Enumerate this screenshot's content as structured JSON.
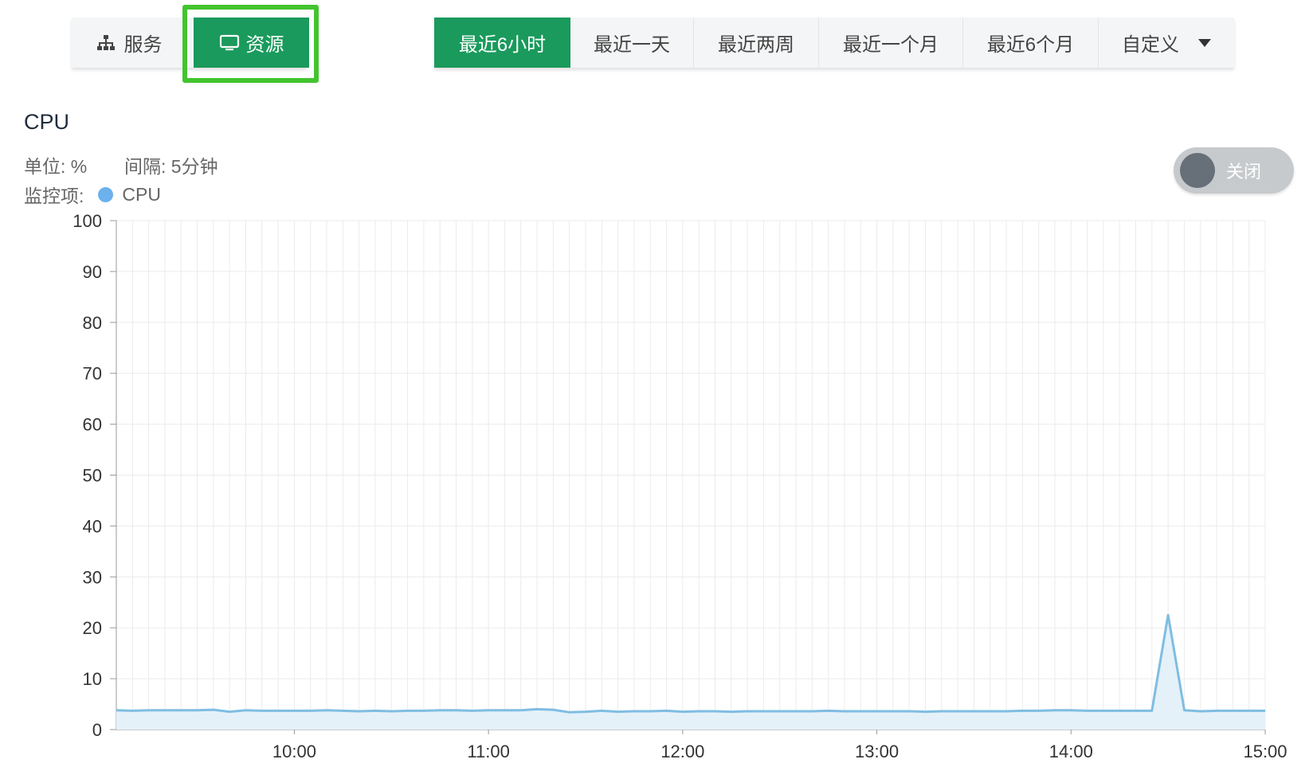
{
  "tabs": {
    "services_label": "服务",
    "resources_label": "资源",
    "services_icon": "sitemap-icon",
    "resources_icon": "monitor-icon"
  },
  "time_range": {
    "options": [
      "最近6小时",
      "最近一天",
      "最近两周",
      "最近一个月",
      "最近6个月",
      "自定义"
    ],
    "selected": "最近6小时"
  },
  "chart_header": {
    "title": "CPU",
    "unit": "单位: %",
    "interval": "间隔: 5分钟",
    "series_label": "监控项:",
    "series_name": "CPU"
  },
  "toggle": {
    "label": "关闭",
    "state": "off"
  },
  "colors": {
    "accent": "#1a9a5c",
    "highlight_outline": "#43c42f",
    "series_line": "#7fbde2",
    "series_fill": "#e5f1f9",
    "legend_dot": "#6bb1ec"
  },
  "chart_data": {
    "type": "area",
    "title": "CPU",
    "ylim": [
      0,
      100
    ],
    "yticks": [
      0,
      10,
      20,
      30,
      40,
      50,
      60,
      70,
      80,
      90,
      100
    ],
    "xlim": [
      "09:05",
      "15:00"
    ],
    "xticks": [
      "10:00",
      "11:00",
      "12:00",
      "13:00",
      "14:00",
      "15:00"
    ],
    "grid": true,
    "x_interval_minutes": 5,
    "series": [
      {
        "name": "CPU",
        "x": [
          "09:05",
          "09:10",
          "09:15",
          "09:20",
          "09:25",
          "09:30",
          "09:35",
          "09:40",
          "09:45",
          "09:50",
          "09:55",
          "10:00",
          "10:05",
          "10:10",
          "10:15",
          "10:20",
          "10:25",
          "10:30",
          "10:35",
          "10:40",
          "10:45",
          "10:50",
          "10:55",
          "11:00",
          "11:05",
          "11:10",
          "11:15",
          "11:20",
          "11:25",
          "11:30",
          "11:35",
          "11:40",
          "11:45",
          "11:50",
          "11:55",
          "12:00",
          "12:05",
          "12:10",
          "12:15",
          "12:20",
          "12:25",
          "12:30",
          "12:35",
          "12:40",
          "12:45",
          "12:50",
          "12:55",
          "13:00",
          "13:05",
          "13:10",
          "13:15",
          "13:20",
          "13:25",
          "13:30",
          "13:35",
          "13:40",
          "13:45",
          "13:50",
          "13:55",
          "14:00",
          "14:05",
          "14:10",
          "14:15",
          "14:20",
          "14:25",
          "14:30",
          "14:35",
          "14:40",
          "14:45",
          "14:50",
          "14:55",
          "15:00"
        ],
        "values": [
          3.8,
          3.7,
          3.8,
          3.8,
          3.8,
          3.8,
          3.9,
          3.5,
          3.8,
          3.7,
          3.7,
          3.7,
          3.7,
          3.8,
          3.7,
          3.6,
          3.7,
          3.6,
          3.7,
          3.7,
          3.8,
          3.8,
          3.7,
          3.8,
          3.8,
          3.8,
          4.0,
          3.9,
          3.4,
          3.5,
          3.7,
          3.5,
          3.6,
          3.6,
          3.7,
          3.5,
          3.6,
          3.6,
          3.5,
          3.6,
          3.6,
          3.6,
          3.6,
          3.6,
          3.7,
          3.6,
          3.6,
          3.6,
          3.6,
          3.6,
          3.5,
          3.6,
          3.6,
          3.6,
          3.6,
          3.6,
          3.7,
          3.7,
          3.8,
          3.8,
          3.7,
          3.7,
          3.7,
          3.7,
          3.7,
          22.5,
          3.8,
          3.6,
          3.7,
          3.7,
          3.7,
          3.7
        ]
      }
    ]
  }
}
